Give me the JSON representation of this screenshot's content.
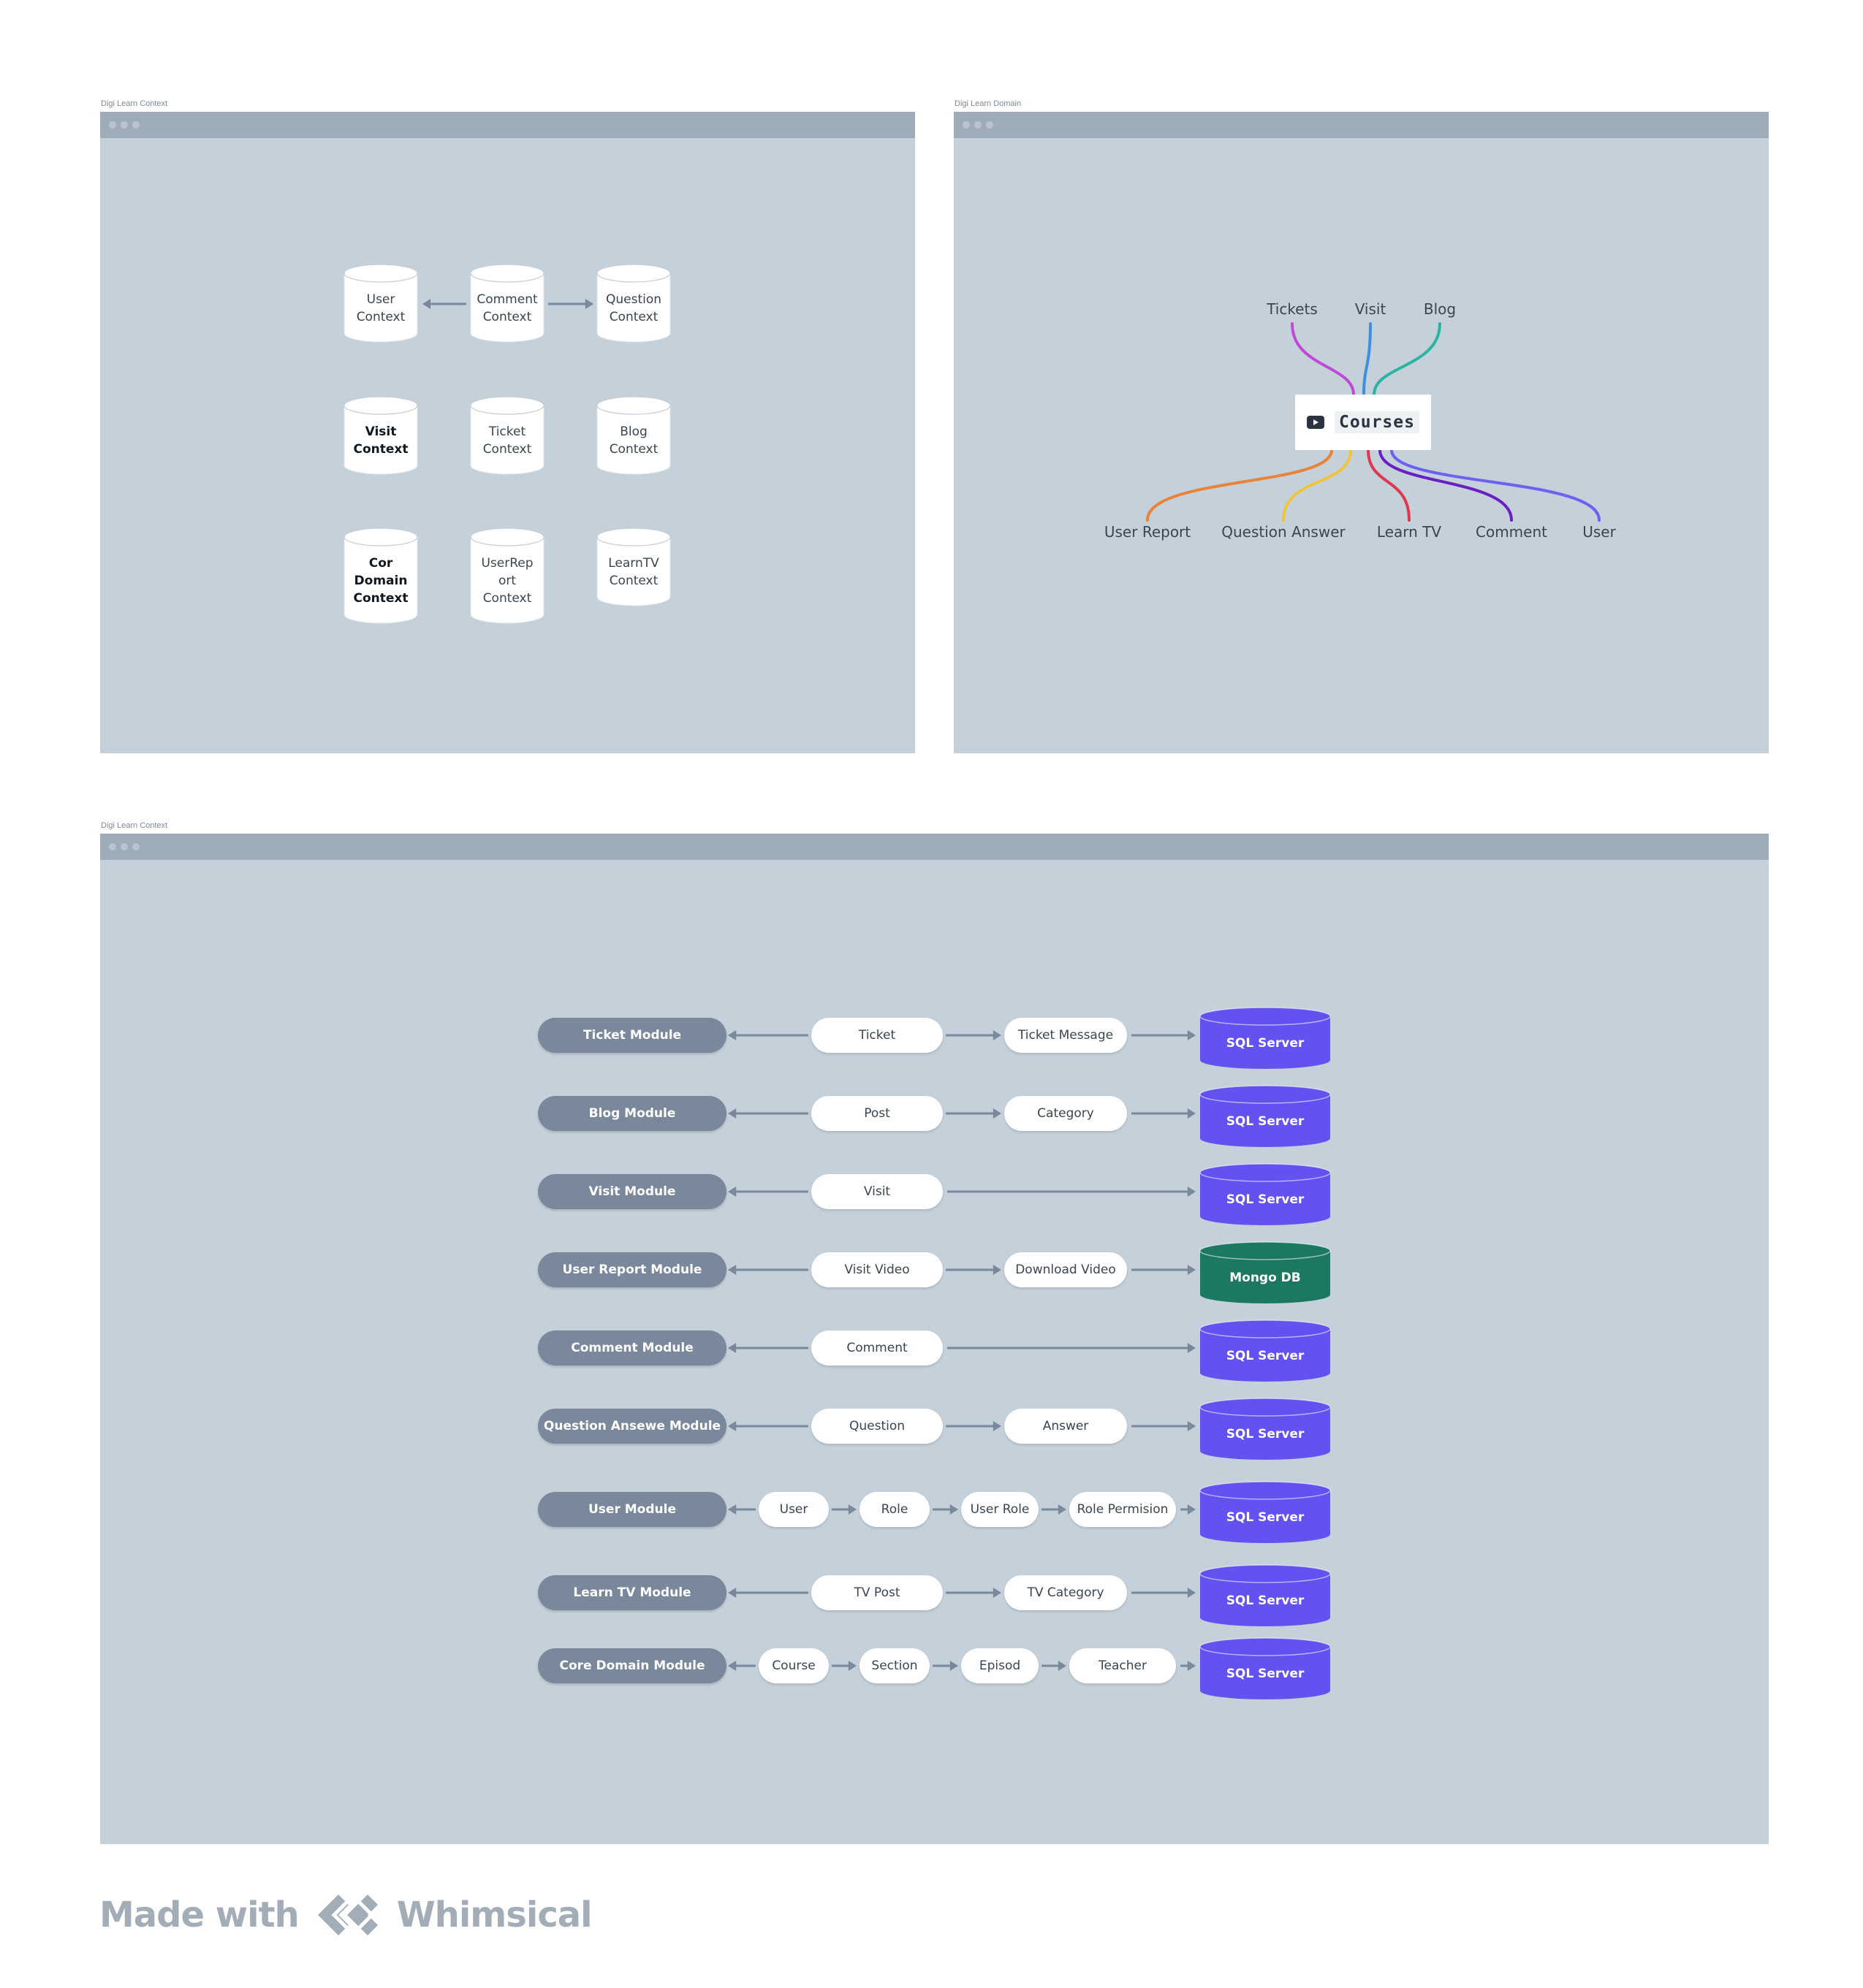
{
  "frames": {
    "context": {
      "title": "Digi Learn Context"
    },
    "domain": {
      "title": "Digi Learn Domain"
    },
    "modules": {
      "title": "Digi Learn Context"
    }
  },
  "contexts": [
    {
      "lines": [
        "User",
        "Context"
      ],
      "bold": false
    },
    {
      "lines": [
        "Comment",
        "Context"
      ],
      "bold": false
    },
    {
      "lines": [
        "Question",
        "Context"
      ],
      "bold": false
    },
    {
      "lines": [
        "Visit",
        "Context"
      ],
      "bold": true
    },
    {
      "lines": [
        "Ticket",
        "Context"
      ],
      "bold": false
    },
    {
      "lines": [
        "Blog",
        "Context"
      ],
      "bold": false
    },
    {
      "lines": [
        "Cor",
        "Domain",
        "Context"
      ],
      "bold": true
    },
    {
      "lines": [
        "UserRep",
        "ort",
        "Context"
      ],
      "bold": false
    },
    {
      "lines": [
        "LearnTV",
        "Context"
      ],
      "bold": false
    }
  ],
  "domain_map": {
    "center": "Courses",
    "center_icon": "video-play-icon",
    "top": [
      {
        "label": "Tickets",
        "color": "#c04ad6"
      },
      {
        "label": "Visit",
        "color": "#3d8fe0"
      },
      {
        "label": "Blog",
        "color": "#2bb5a0"
      }
    ],
    "bottom": [
      {
        "label": "User Report",
        "color": "#e8843a"
      },
      {
        "label": "Question Answer",
        "color": "#f0c33c"
      },
      {
        "label": "Learn TV",
        "color": "#e0384e"
      },
      {
        "label": "Comment",
        "color": "#6a1fc2"
      },
      {
        "label": "User",
        "color": "#6b62f0"
      }
    ]
  },
  "modules": [
    {
      "module": "Ticket Module",
      "nodes": [
        "Ticket",
        "Ticket Message"
      ],
      "db": "SQL Server",
      "db_color": "#6352ef"
    },
    {
      "module": "Blog Module",
      "nodes": [
        "Post",
        "Category"
      ],
      "db": "SQL Server",
      "db_color": "#6352ef"
    },
    {
      "module": "Visit Module",
      "nodes": [
        "Visit"
      ],
      "db": "SQL Server",
      "db_color": "#6352ef"
    },
    {
      "module": "User Report Module",
      "nodes": [
        "Visit Video",
        "Download Video"
      ],
      "db": "Mongo DB",
      "db_color": "#1d7862"
    },
    {
      "module": "Comment Module",
      "nodes": [
        "Comment"
      ],
      "db": "SQL Server",
      "db_color": "#6352ef"
    },
    {
      "module": "Question Ansewe Module",
      "nodes": [
        "Question",
        "Answer"
      ],
      "db": "SQL Server",
      "db_color": "#6352ef"
    },
    {
      "module": "User Module",
      "nodes": [
        "User",
        "Role",
        "User Role",
        "Role Permision"
      ],
      "db": "SQL Server",
      "db_color": "#6352ef"
    },
    {
      "module": "Learn TV Module",
      "nodes": [
        "TV Post",
        "TV Category"
      ],
      "db": "SQL Server",
      "db_color": "#6352ef"
    },
    {
      "module": "Core Domain Module",
      "nodes": [
        "Course",
        "Section",
        "Episod",
        "Teacher"
      ],
      "db": "SQL Server",
      "db_color": "#6352ef"
    }
  ],
  "footer": {
    "made_with": "Made with",
    "brand": "Whimsical"
  }
}
